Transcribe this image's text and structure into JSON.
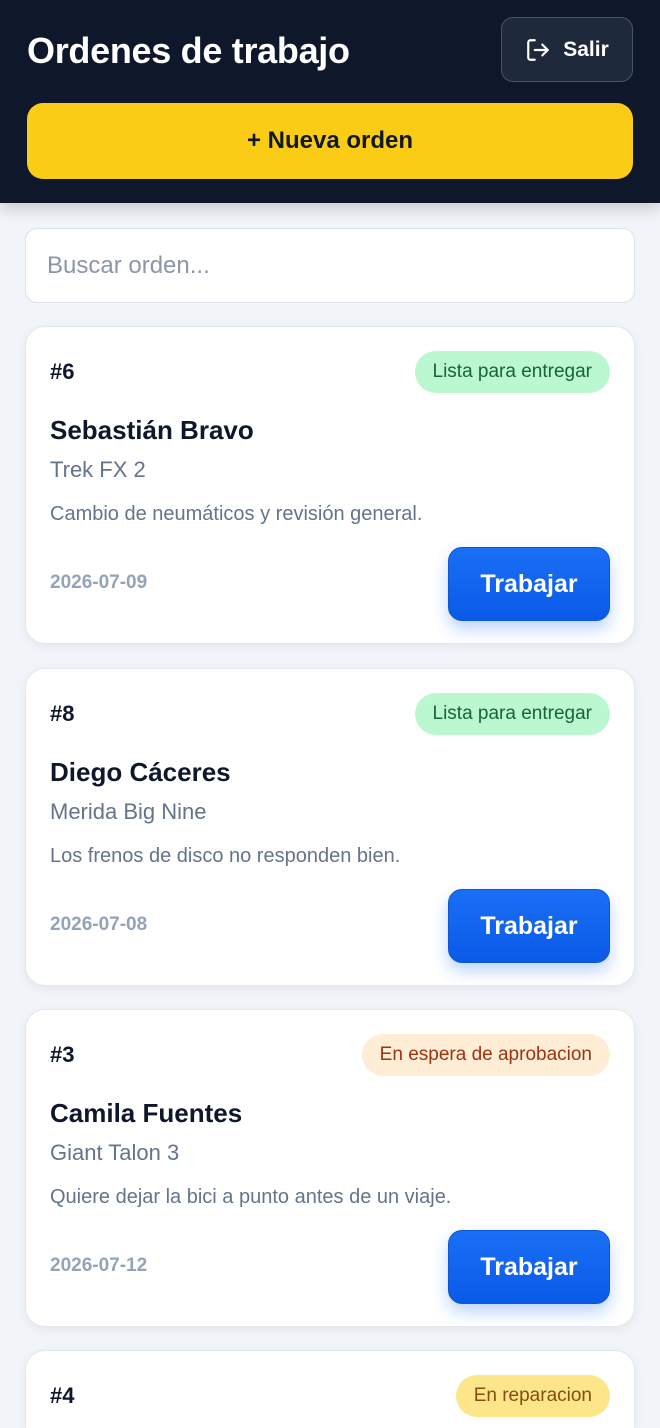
{
  "header": {
    "title": "Ordenes de trabajo",
    "logout_label": "Salir",
    "logout_icon": "logout-icon",
    "new_order_label": "+ Nueva orden"
  },
  "search": {
    "placeholder": "Buscar orden..."
  },
  "orders": [
    {
      "id": "#6",
      "status": "Lista para entregar",
      "customer": "Sebastián Bravo",
      "bike": "Trek FX 2",
      "description": "Cambio de neumáticos y revisión general.",
      "date": "2026-07-09",
      "action_label": "Trabajar"
    },
    {
      "id": "#8",
      "status": "Lista para entregar",
      "customer": "Diego Cáceres",
      "bike": "Merida Big Nine",
      "description": "Los frenos de disco no responden bien.",
      "date": "2026-07-08",
      "action_label": "Trabajar"
    },
    {
      "id": "#3",
      "status": "En espera de aprobacion",
      "customer": "Camila Fuentes",
      "bike": "Giant Talon 3",
      "description": "Quiere dejar la bici a punto antes de un viaje.",
      "date": "2026-07-12",
      "action_label": "Trabajar"
    },
    {
      "id": "#4",
      "status": "En reparacion"
    }
  ],
  "colors": {
    "header_bg": "#0f172a",
    "accent_yellow": "#facc15",
    "primary_blue": "#0a63f0",
    "status_ready": "#bbf7d0",
    "status_waiting": "#ffedd5",
    "status_repair": "#fde68a"
  }
}
